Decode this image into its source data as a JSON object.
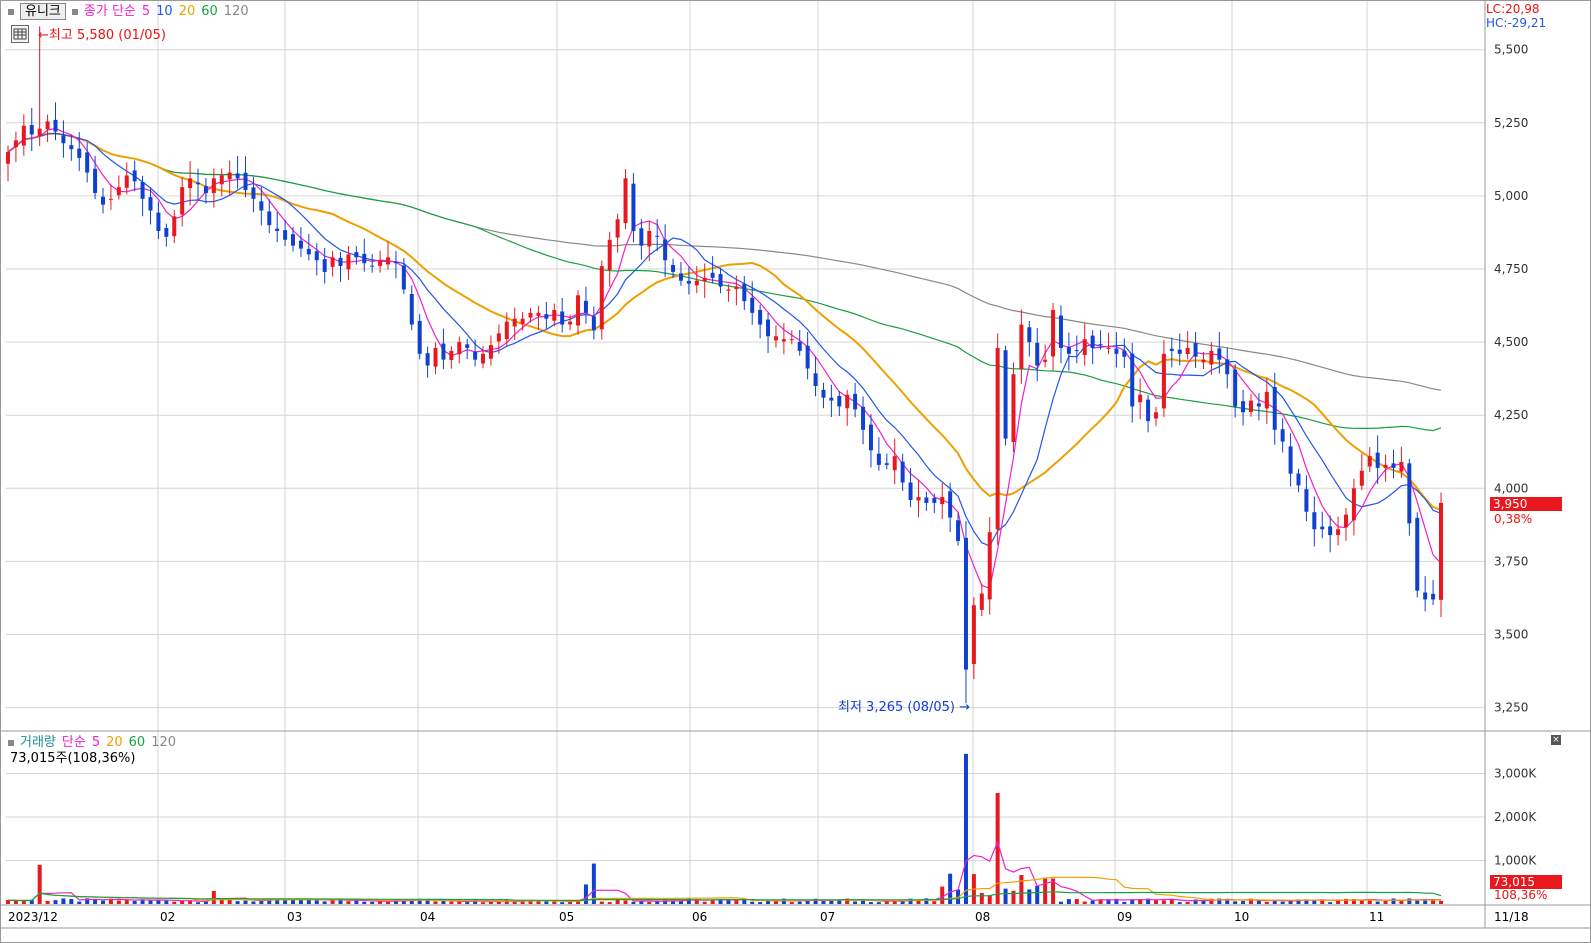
{
  "price_legend": {
    "title": "유니크",
    "ma_label": "종가 단순",
    "periods": [
      "5",
      "10",
      "20",
      "60",
      "120"
    ],
    "colors": {
      "5": "#ee22cc",
      "10": "#2255ee",
      "20": "#eea000",
      "60": "#18a040",
      "120": "#888888"
    }
  },
  "volume_legend": {
    "title": "거래량",
    "ma_label": "단순",
    "periods": [
      "5",
      "20",
      "60",
      "120"
    ],
    "current": "73,015주(108,36%)"
  },
  "top_right": {
    "lc": "LC:20,98",
    "hc": "HC:-29,21"
  },
  "price_box": {
    "value": "3,950",
    "change": "0,38%"
  },
  "volume_box": {
    "value": "73,015",
    "change": "108,36%"
  },
  "annotations": {
    "high": "최고 5,580 (01/05)",
    "low": "최저 3,265 (08/05)"
  },
  "colors": {
    "up": "#e8181e",
    "down": "#1040d0",
    "grid": "#d6d6d6"
  },
  "chart_data": [
    {
      "type": "candlestick",
      "title": "유니크",
      "y_ticks": [
        "5,500",
        "5,250",
        "5,000",
        "4,750",
        "4,500",
        "4,250",
        "4,000",
        "3,750",
        "3,500",
        "3,250"
      ],
      "y_tick_values": [
        5500,
        5250,
        5000,
        4750,
        4500,
        4250,
        4000,
        3750,
        3500,
        3250
      ],
      "ylim": [
        3170,
        5670
      ],
      "x_ticks": [
        "2023/12",
        "02",
        "03",
        "04",
        "05",
        "06",
        "07",
        "08",
        "09",
        "10",
        "11",
        "11/18"
      ],
      "last_close": 3950,
      "high": {
        "value": 5580,
        "date": "01/05"
      },
      "low": {
        "value": 3265,
        "date": "08/05"
      },
      "close_series": [
        5150,
        5190,
        5240,
        5210,
        5230,
        5255,
        5220,
        5180,
        5160,
        5130,
        5080,
        5010,
        4970,
        4990,
        5030,
        5070,
        5050,
        4990,
        4950,
        4880,
        4860,
        4930,
        5030,
        5060,
        5040,
        5010,
        5060,
        5070,
        5080,
        5060,
        5020,
        4990,
        4950,
        4900,
        4880,
        4850,
        4830,
        4820,
        4800,
        4780,
        4740,
        4790,
        4760,
        4800,
        4790,
        4770,
        4760,
        4780,
        4790,
        4770,
        4680,
        4560,
        4460,
        4420,
        4480,
        4440,
        4470,
        4500,
        4480,
        4440,
        4460,
        4490,
        4530,
        4570,
        4580,
        4580,
        4600,
        4600,
        4580,
        4610,
        4560,
        4570,
        4660,
        4600,
        4540,
        4760,
        4850,
        4920,
        5060,
        4880,
        4830,
        4880,
        4860,
        4780,
        4740,
        4710,
        4700,
        4710,
        4720,
        4720,
        4690,
        4680,
        4690,
        4640,
        4600,
        4560,
        4520,
        4520,
        4510,
        4510,
        4470,
        4410,
        4350,
        4310,
        4300,
        4280,
        4320,
        4270,
        4200,
        4130,
        4080,
        4080,
        4110,
        4020,
        3960,
        3970,
        3950,
        3950,
        3970,
        3900,
        3820,
        3380,
        3600,
        3640,
        3850,
        4480,
        4170,
        4390,
        4560,
        4500,
        4420,
        4440,
        4610,
        4480,
        4460,
        4470,
        4510,
        4480,
        4490,
        4480,
        4460,
        4450,
        4280,
        4320,
        4230,
        4260,
        4460,
        4470,
        4460,
        4480,
        4450,
        4440,
        4470,
        4440,
        4390,
        4280,
        4260,
        4300,
        4280,
        4330,
        4200,
        4160,
        4050,
        4010,
        3920,
        3860,
        3860,
        3840,
        3860,
        3910,
        4000,
        4060,
        4110,
        4070,
        4080,
        4070,
        4090,
        3880,
        3650,
        3620,
        3620,
        3950
      ],
      "volume_ticks": [
        "3,000K",
        "2,000K",
        "1,000K"
      ],
      "volume_tick_values": [
        3000,
        2000,
        1000
      ],
      "volume_ylim": [
        0,
        3700
      ],
      "volume_spikes": [
        {
          "index": 4,
          "value": 900
        },
        {
          "index": 26,
          "value": 300
        },
        {
          "index": 73,
          "value": 450
        },
        {
          "index": 74,
          "value": 930
        },
        {
          "index": 121,
          "value": 3450
        },
        {
          "index": 125,
          "value": 2550
        }
      ],
      "last_volume": 73.015
    }
  ]
}
